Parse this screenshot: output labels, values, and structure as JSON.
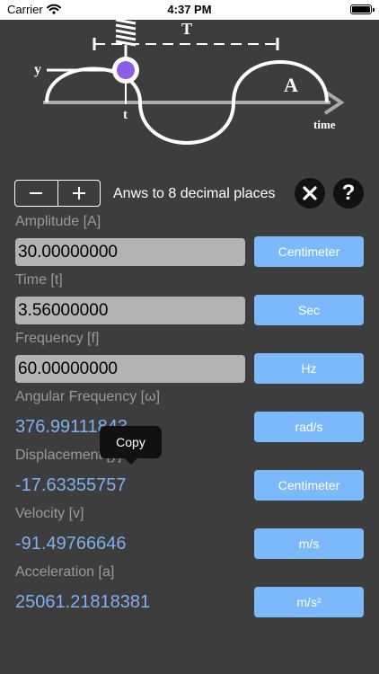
{
  "status_bar": {
    "carrier": "Carrier",
    "time": "4:37 PM",
    "battery_level": 1.0
  },
  "diagram": {
    "label_t_period": "T",
    "label_y": "y",
    "label_t": "t",
    "label_a": "A",
    "label_time": "time"
  },
  "toolbar": {
    "minus": "−",
    "plus": "+",
    "decimals_text": "Anws to 8 decimal places",
    "help": "?"
  },
  "fields": [
    {
      "label": "Amplitude [A]",
      "value": "30.00000000",
      "unit": "Centimeter"
    },
    {
      "label": "Time [t]",
      "value": "3.56000000",
      "unit": "Sec"
    },
    {
      "label": "Frequency [f]",
      "value": "60.00000000",
      "unit": "Hz"
    },
    {
      "label": "Angular Frequency [ω]",
      "value": "376.99111843",
      "unit": "rad/s"
    },
    {
      "label": "Displacement [y]",
      "value": "-17.63355757",
      "unit": "Centimeter"
    },
    {
      "label": "Velocity [v]",
      "value": "-91.49766646",
      "unit": "m/s"
    },
    {
      "label": "Acceleration [a]",
      "value": "25061.21818381",
      "unit": "m/s²"
    }
  ],
  "tooltip": {
    "copy": "Copy"
  },
  "colors": {
    "background": "#3d3d3d",
    "unit_button": "#7cb9fb",
    "output_text": "#7fb0f0",
    "bob": "#8e5de8"
  }
}
